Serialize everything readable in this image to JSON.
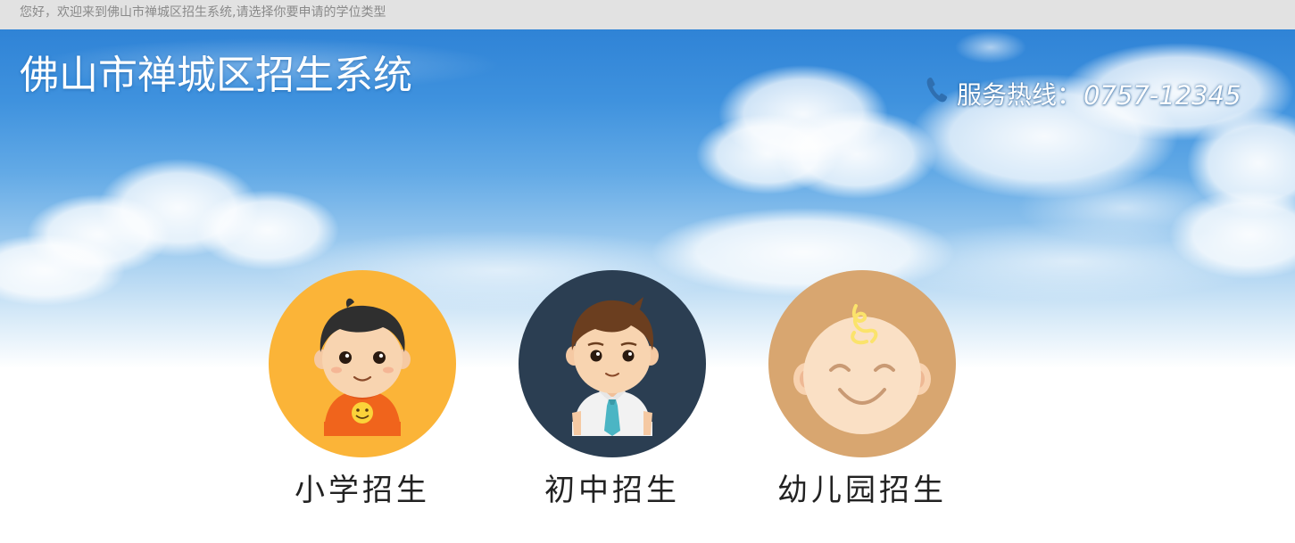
{
  "topbar": {
    "welcome_text": "您好，欢迎来到佛山市禅城区招生系统,请选择你要申请的学位类型"
  },
  "header": {
    "site_title": "佛山市禅城区招生系统",
    "hotline_label": "服务热线：",
    "hotline_number": "0757-12345",
    "hotline_icon": "phone-icon"
  },
  "options": [
    {
      "label": "小学招生",
      "icon": "boy-child-avatar-icon",
      "color": "#fbb438"
    },
    {
      "label": "初中招生",
      "icon": "teen-student-avatar-icon",
      "color": "#2b3e52"
    },
    {
      "label": "幼儿园招生",
      "icon": "baby-avatar-icon",
      "color": "#d8a670"
    }
  ],
  "colors": {
    "sky_top": "#2f83d6",
    "topbar_bg": "#e2e2e2",
    "topbar_text": "#8a8a8a",
    "label_text": "#222222"
  }
}
